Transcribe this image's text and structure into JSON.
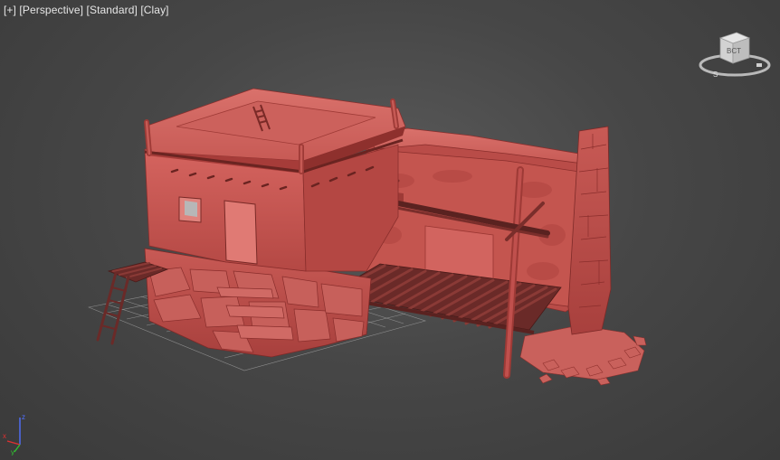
{
  "viewport": {
    "labels": {
      "plus": "[+]",
      "view": "[Perspective]",
      "shading_style": "[Standard]",
      "display_mode": "[Clay]"
    },
    "background": "#474747",
    "model_color": "#c0504d",
    "grid_color": "#9a9a9a"
  },
  "viewcube": {
    "face_label": "BCT",
    "compass_label": "S"
  },
  "axis_tripod": {
    "x": "x",
    "y": "y",
    "z": "z",
    "colors": {
      "x": "#e03030",
      "y": "#30c030",
      "z": "#5070ff"
    }
  }
}
